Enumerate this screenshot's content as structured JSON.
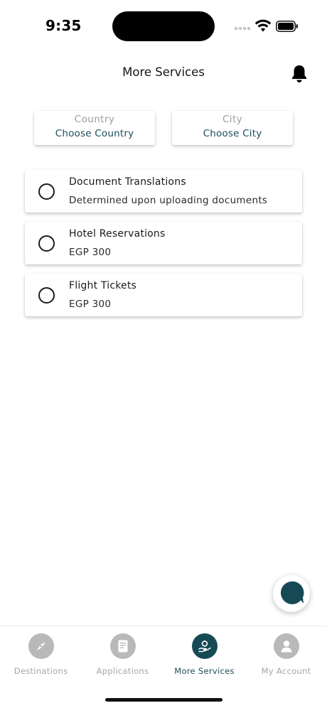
{
  "status_bar": {
    "time": "9:35"
  },
  "header": {
    "title": "More Services"
  },
  "filters": {
    "country": {
      "label": "Country",
      "value": "Choose Country"
    },
    "city": {
      "label": "City",
      "value": "Choose City"
    }
  },
  "services": [
    {
      "name": "Document Translations",
      "price": "Determined upon uploading documents",
      "selected": false
    },
    {
      "name": "Hotel Reservations",
      "price": "EGP 300",
      "selected": false
    },
    {
      "name": "Flight Tickets",
      "price": "EGP 300",
      "selected": false
    }
  ],
  "bottom_nav": {
    "items": [
      {
        "label": "Destinations",
        "icon": "compass-icon",
        "active": false
      },
      {
        "label": "Applications",
        "icon": "document-icon",
        "active": false
      },
      {
        "label": "More Services",
        "icon": "hand-service-icon",
        "active": true
      },
      {
        "label": "My Account",
        "icon": "user-icon",
        "active": false
      }
    ]
  },
  "colors": {
    "accent": "#154a55",
    "inactive": "#b9b9b9",
    "text_teal": "#1b4d5a"
  }
}
